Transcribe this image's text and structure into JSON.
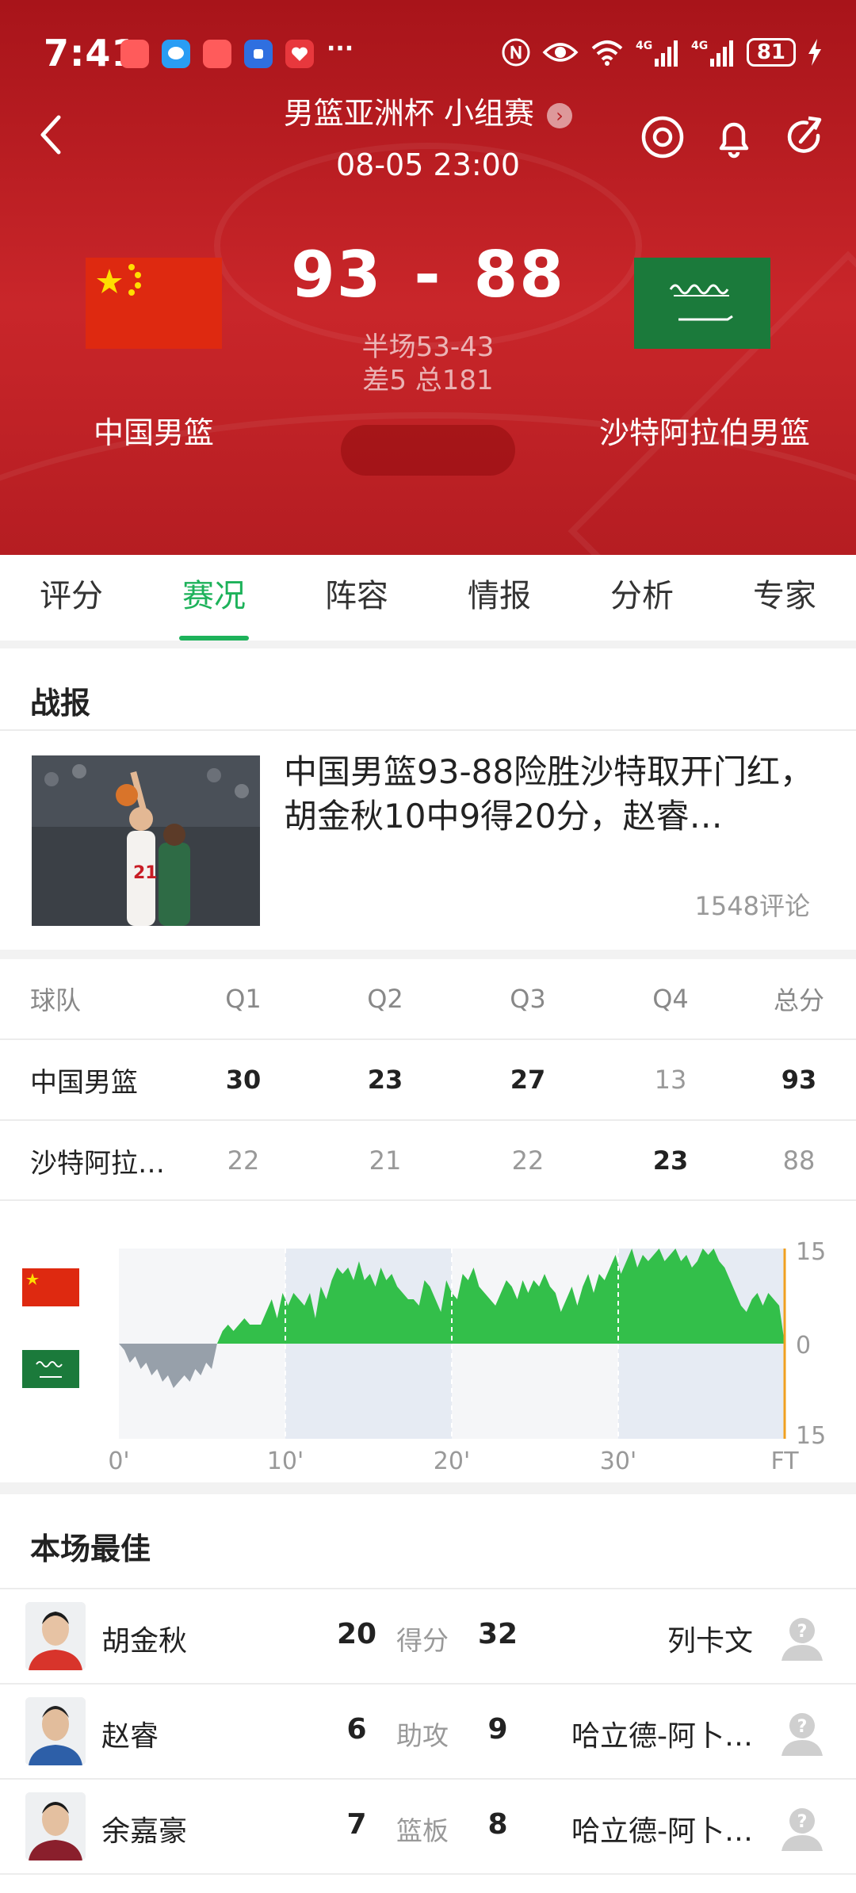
{
  "status_bar": {
    "time": "7:41",
    "more": "···",
    "battery": "81"
  },
  "header": {
    "league": "男篮亚洲杯 小组赛",
    "kickoff": "08-05 23:00",
    "home_team": "中国男篮",
    "away_team": "沙特阿拉伯男篮",
    "home_score": "93",
    "dash": "-",
    "away_score": "88",
    "halftime": "半场53-43",
    "diff_total": "差5 总181"
  },
  "tabs": [
    {
      "label": "评分"
    },
    {
      "label": "赛况",
      "active": true
    },
    {
      "label": "阵容"
    },
    {
      "label": "情报"
    },
    {
      "label": "分析"
    },
    {
      "label": "专家"
    }
  ],
  "news": {
    "section_title": "战报",
    "headline": "中国男篮93-88险胜沙特取开门红，胡金秋10中9得20分，赵睿…",
    "comments": "1548评论"
  },
  "score_table": {
    "headers": [
      "球队",
      "Q1",
      "Q2",
      "Q3",
      "Q4",
      "总分"
    ],
    "rows": [
      {
        "team": "中国男篮",
        "q": [
          "30",
          "23",
          "27",
          "13",
          "93"
        ]
      },
      {
        "team": "沙特阿拉…",
        "q": [
          "22",
          "21",
          "22",
          "23",
          "88"
        ]
      }
    ]
  },
  "chart_data": {
    "type": "area",
    "x_ticks": [
      "0'",
      "10'",
      "20'",
      "30'",
      "FT"
    ],
    "y_ticks": [
      "15",
      "0",
      "15"
    ],
    "ylim": [
      -15,
      15
    ],
    "x_range": [
      0,
      40
    ],
    "colors": {
      "home": "#33bf4a",
      "away": "#97a0aa"
    },
    "series": [
      {
        "values": [
          0,
          -1,
          -3,
          -2,
          -4,
          -3,
          -5,
          -4,
          -6,
          -5,
          -7,
          -6,
          -5,
          -6,
          -4,
          -5,
          -3,
          -4,
          0,
          2,
          3,
          2,
          3,
          4,
          3,
          3,
          3,
          5,
          7,
          4,
          8,
          6,
          8,
          7,
          6,
          8,
          4,
          9,
          7,
          10,
          12,
          11,
          12,
          10,
          13,
          10,
          11,
          9,
          12,
          10,
          11,
          9,
          8,
          7,
          7,
          6,
          10,
          9,
          7,
          5,
          10,
          8,
          7,
          11,
          10,
          12,
          9,
          8,
          7,
          6,
          8,
          10,
          9,
          7,
          10,
          8,
          10,
          9,
          11,
          9,
          8,
          5,
          7,
          9,
          6,
          9,
          11,
          8,
          11,
          10,
          12,
          14,
          11,
          13,
          15,
          12,
          14,
          13,
          14,
          15,
          13,
          14,
          15,
          13,
          14,
          12,
          13,
          15,
          14,
          15,
          13,
          12,
          10,
          8,
          6,
          5,
          7,
          8,
          6,
          8,
          7,
          6,
          0
        ]
      }
    ]
  },
  "best_players": {
    "section_title": "本场最佳",
    "rows": [
      {
        "home_name": "胡金秋",
        "home_val": "20",
        "stat": "得分",
        "away_val": "32",
        "away_name": "列卡文"
      },
      {
        "home_name": "赵睿",
        "home_val": "6",
        "stat": "助攻",
        "away_val": "9",
        "away_name": "哈立德-阿卜…"
      },
      {
        "home_name": "余嘉豪",
        "home_val": "7",
        "stat": "篮板",
        "away_val": "8",
        "away_name": "哈立德-阿卜…"
      }
    ]
  }
}
